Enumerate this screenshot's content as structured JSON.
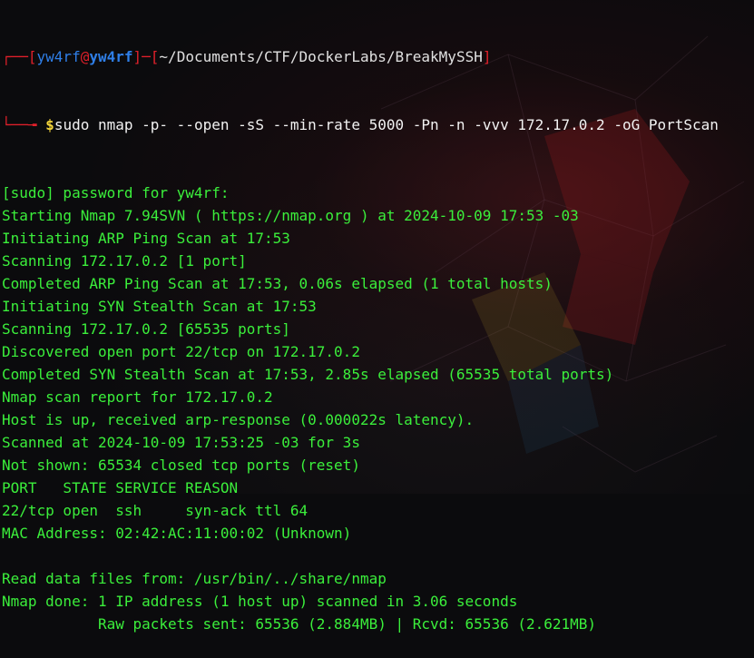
{
  "prompt": {
    "open_bracket": "┌──[",
    "user": "yw4rf",
    "at": "@",
    "host": "yw4rf",
    "mid": "]─[",
    "path": "~/Documents/CTF/DockerLabs/BreakMySSH",
    "close": "]",
    "corner": "└──╼ ",
    "dollar": "$",
    "command": "sudo nmap -p- --open -sS --min-rate 5000 -Pn -n -vvv 172.17.0.2 -oG PortScan"
  },
  "output_lines": [
    "[sudo] password for yw4rf:",
    "Starting Nmap 7.94SVN ( https://nmap.org ) at 2024-10-09 17:53 -03",
    "Initiating ARP Ping Scan at 17:53",
    "Scanning 172.17.0.2 [1 port]",
    "Completed ARP Ping Scan at 17:53, 0.06s elapsed (1 total hosts)",
    "Initiating SYN Stealth Scan at 17:53",
    "Scanning 172.17.0.2 [65535 ports]",
    "Discovered open port 22/tcp on 172.17.0.2",
    "Completed SYN Stealth Scan at 17:53, 2.85s elapsed (65535 total ports)",
    "Nmap scan report for 172.17.0.2",
    "Host is up, received arp-response (0.000022s latency).",
    "Scanned at 2024-10-09 17:53:25 -03 for 3s",
    "Not shown: 65534 closed tcp ports (reset)",
    "PORT   STATE SERVICE REASON",
    "22/tcp open  ssh     syn-ack ttl 64",
    "MAC Address: 02:42:AC:11:00:02 (Unknown)",
    "",
    "Read data files from: /usr/bin/../share/nmap",
    "Nmap done: 1 IP address (1 host up) scanned in 3.06 seconds",
    "           Raw packets sent: 65536 (2.884MB) | Rcvd: 65536 (2.621MB)"
  ],
  "colors": {
    "output": "#3bef3b",
    "prompt_frame": "#e0202a",
    "user_host": "#2f7fe8",
    "dollar": "#f2d43a",
    "background": "#0b0b0d"
  }
}
